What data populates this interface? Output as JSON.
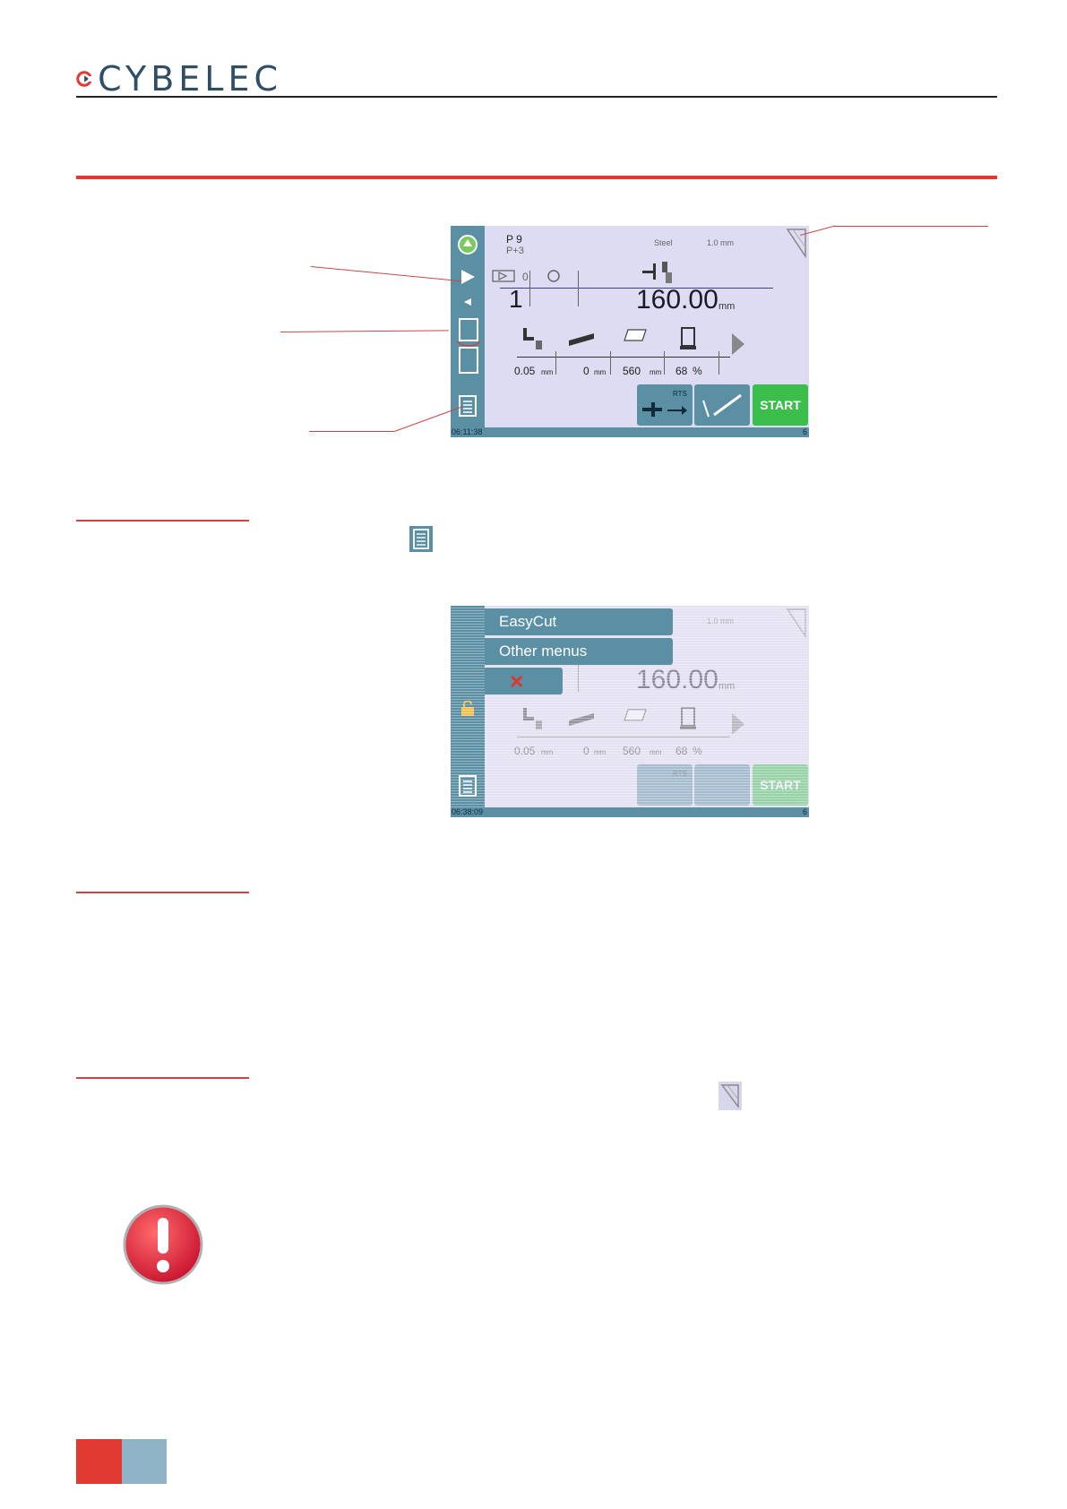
{
  "header": {
    "brand": "CYBELEC"
  },
  "screen1": {
    "program_line1": "P  9",
    "program_line2": "P+3",
    "material": "Steel",
    "thickness": "1.0 mm",
    "counter_small": "0",
    "count": "1",
    "x_value": "160.00",
    "x_unit": "mm",
    "params": [
      {
        "value": "0.05",
        "unit": "mm"
      },
      {
        "value": "0",
        "unit": "mm"
      },
      {
        "value": "560",
        "unit": "mm"
      },
      {
        "value": "68",
        "unit": "%"
      }
    ],
    "rts_label": "RTS",
    "start_label": "START",
    "time": "06:11:38",
    "corner_digit": "6"
  },
  "screen2": {
    "menu": [
      "EasyCut",
      "Other menus"
    ],
    "close_icon": "×",
    "thickness": "1.0 mm",
    "x_value": "160.00",
    "x_unit": "mm",
    "params": [
      {
        "value": "0.05",
        "unit": "mm"
      },
      {
        "value": "0",
        "unit": "mm"
      },
      {
        "value": "560",
        "unit": "mm"
      },
      {
        "value": "68",
        "unit": "%"
      }
    ],
    "rts_label": "RTS",
    "start_label": "START",
    "time": "06:38:09",
    "corner_digit": "6"
  },
  "colors": {
    "accent_red": "#e03a33",
    "screen_bg": "#dedcf2",
    "panel_blue": "#5a8fa4",
    "start_green": "#3cbe4c",
    "footer_blue": "#8fb3c6"
  },
  "icons": [
    "logo-c-icon",
    "play-icon",
    "list-icon",
    "tool-corner-icon",
    "warning-icon",
    "close-icon"
  ]
}
